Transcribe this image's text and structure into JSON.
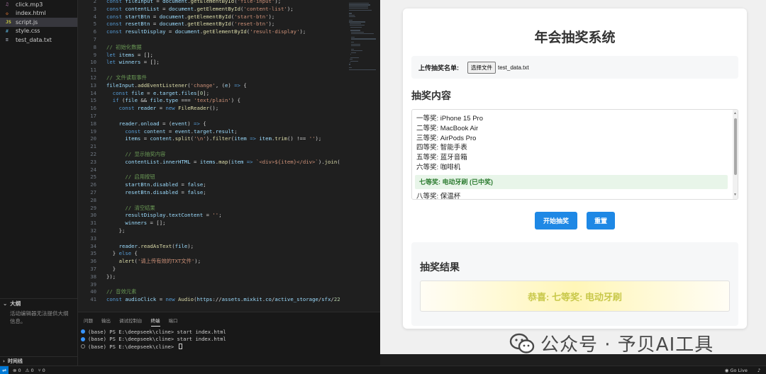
{
  "explorer": {
    "files": [
      {
        "icon": "audio-file-icon",
        "glyph": "♫",
        "color": "#c586c0",
        "name": "click.mp3"
      },
      {
        "icon": "html-file-icon",
        "glyph": "◇",
        "color": "#e37933",
        "name": "index.html"
      },
      {
        "icon": "js-file-icon",
        "glyph": "JS",
        "color": "#cbcb41",
        "name": "script.js"
      },
      {
        "icon": "css-file-icon",
        "glyph": "#",
        "color": "#519aba",
        "name": "style.css"
      },
      {
        "icon": "text-file-icon",
        "glyph": "≡",
        "color": "#9da5b4",
        "name": "test_data.txt"
      }
    ],
    "outline_title": "大纲",
    "outline_msg": "活动编辑器无法提供大纲信息。",
    "timeline_title": "时间线"
  },
  "code_lines": [
    {
      "n": "2",
      "t": "const fileInput = document.getElementById('file-input');"
    },
    {
      "n": "3",
      "t": "const contentList = document.getElementById('content-list');"
    },
    {
      "n": "4",
      "t": "const startBtn = document.getElementById('start-btn');"
    },
    {
      "n": "5",
      "t": "const resetBtn = document.getElementById('reset-btn');"
    },
    {
      "n": "6",
      "t": "const resultDisplay = document.getElementById('result-display');"
    },
    {
      "n": "7",
      "t": ""
    },
    {
      "n": "8",
      "t": "// 初始化数据"
    },
    {
      "n": "9",
      "t": "let items = [];"
    },
    {
      "n": "10",
      "t": "let winners = [];"
    },
    {
      "n": "11",
      "t": ""
    },
    {
      "n": "12",
      "t": "// 文件读取事件"
    },
    {
      "n": "13",
      "t": "fileInput.addEventListener('change', (e) => {"
    },
    {
      "n": "14",
      "t": "  const file = e.target.files[0];"
    },
    {
      "n": "15",
      "t": "  if (file && file.type === 'text/plain') {"
    },
    {
      "n": "16",
      "t": "    const reader = new FileReader();"
    },
    {
      "n": "17",
      "t": ""
    },
    {
      "n": "18",
      "t": "    reader.onload = (event) => {"
    },
    {
      "n": "19",
      "t": "      const content = event.target.result;"
    },
    {
      "n": "20",
      "t": "      items = content.split('\\n').filter(item => item.trim() !== '');"
    },
    {
      "n": "21",
      "t": ""
    },
    {
      "n": "22",
      "t": "      // 显示抽奖内容"
    },
    {
      "n": "23",
      "t": "      contentList.innerHTML = items.map(item => `<div>${item}</div>`).join('"
    },
    {
      "n": "24",
      "t": ""
    },
    {
      "n": "25",
      "t": "      // 启用按钮"
    },
    {
      "n": "26",
      "t": "      startBtn.disabled = false;"
    },
    {
      "n": "27",
      "t": "      resetBtn.disabled = false;"
    },
    {
      "n": "28",
      "t": ""
    },
    {
      "n": "29",
      "t": "      // 清空结果"
    },
    {
      "n": "30",
      "t": "      resultDisplay.textContent = '';"
    },
    {
      "n": "31",
      "t": "      winners = [];"
    },
    {
      "n": "32",
      "t": "    };"
    },
    {
      "n": "33",
      "t": ""
    },
    {
      "n": "34",
      "t": "    reader.readAsText(file);"
    },
    {
      "n": "35",
      "t": "  } else {"
    },
    {
      "n": "36",
      "t": "    alert('请上传有效的TXT文件');"
    },
    {
      "n": "37",
      "t": "  }"
    },
    {
      "n": "38",
      "t": "});"
    },
    {
      "n": "39",
      "t": ""
    },
    {
      "n": "40",
      "t": "// 音效元素"
    },
    {
      "n": "41",
      "t": "const audioClick = new Audio('https://assets.mixkit.co/active_storage/sfx/22"
    }
  ],
  "panel": {
    "tabs": [
      "问题",
      "输出",
      "调试控制台",
      "终端",
      "端口"
    ],
    "active_tab": 3,
    "terminal_lines": [
      {
        "text": "(base) PS E:\\deepseek\\cline> start index.html",
        "status": "done"
      },
      {
        "text": "(base) PS E:\\deepseek\\cline> start index.html",
        "status": "done"
      },
      {
        "text": "(base) PS E:\\deepseek\\cline> ",
        "status": "idle"
      }
    ]
  },
  "statusbar": {
    "errors": "⊗ 0",
    "warnings": "⚠ 0",
    "ports": "⑂ 0",
    "go_live": "Go Live"
  },
  "app": {
    "title": "年会抽奖系统",
    "upload_label": "上传抽奖名单:",
    "file_button": "选择文件",
    "file_name": "test_data.txt",
    "content_title": "抽奖内容",
    "prizes": [
      {
        "text": "一等奖: iPhone 15 Pro",
        "won": false
      },
      {
        "text": "二等奖: MacBook Air",
        "won": false
      },
      {
        "text": "三等奖: AirPods Pro",
        "won": false
      },
      {
        "text": "四等奖: 智能手表",
        "won": false
      },
      {
        "text": "五等奖: 蓝牙音箱",
        "won": false
      },
      {
        "text": "六等奖: 咖啡机",
        "won": false
      },
      {
        "text": "七等奖: 电动牙刷 (已中奖)",
        "won": true
      },
      {
        "text": "八等奖: 保温杯",
        "won": false
      }
    ],
    "start_button": "开始抽奖",
    "reset_button": "重置",
    "result_title": "抽奖结果",
    "result_text": "恭喜: 七等奖: 电动牙刷"
  },
  "watermark": {
    "text": "公众号 · 予贝AI工具"
  },
  "colors": {
    "accent": "#1e88e5",
    "won_bg": "#e8f5e9",
    "won_text": "#2e7d32",
    "result_text": "#c8c84a"
  }
}
